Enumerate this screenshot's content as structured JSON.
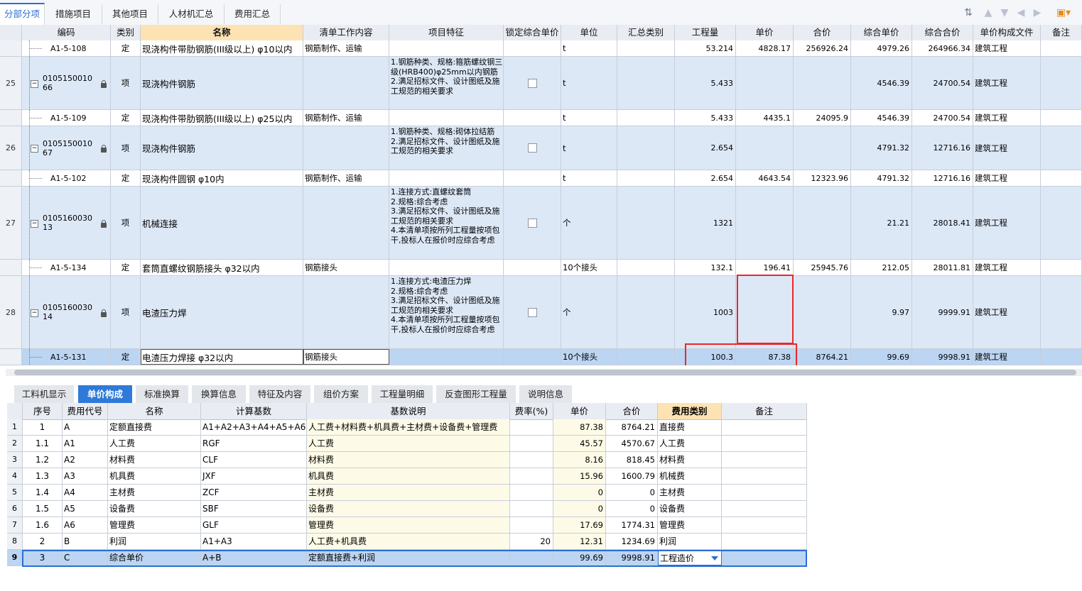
{
  "top_tabs": [
    "分部分项",
    "措施项目",
    "其他项目",
    "人材机汇总",
    "费用汇总"
  ],
  "grid": {
    "headers": [
      "编码",
      "类别",
      "名称",
      "清单工作内容",
      "项目特征",
      "锁定综合单价",
      "单位",
      "汇总类别",
      "工程量",
      "单价",
      "合价",
      "综合单价",
      "综合合价",
      "单价构成文件",
      "备注"
    ],
    "rows": [
      {
        "num": "",
        "code": "A1-5-108",
        "type": "定",
        "name": "现浇构件带肋钢筋(III级以上) φ10以内",
        "content": "钢筋制作、运输",
        "feature": "",
        "unit": "t",
        "qty": "53.214",
        "price": "4828.17",
        "total": "256926.24",
        "cprice": "4979.26",
        "ctotal": "264966.34",
        "file": "建筑工程"
      },
      {
        "num": "25",
        "code": "010515001066",
        "type": "项",
        "name": "现浇构件钢筋",
        "content": "",
        "feature": "1.钢筋种类、规格:箍筋螺纹钢三级(HRB400)φ25mm以内钢筋\n2.满足招标文件、设计图纸及施工规范的相关要求",
        "unit": "t",
        "qty": "5.433",
        "price": "",
        "total": "",
        "cprice": "4546.39",
        "ctotal": "24700.54",
        "file": "建筑工程"
      },
      {
        "num": "",
        "code": "A1-5-109",
        "type": "定",
        "name": "现浇构件带肋钢筋(III级以上) φ25以内",
        "content": "钢筋制作、运输",
        "feature": "",
        "unit": "t",
        "qty": "5.433",
        "price": "4435.1",
        "total": "24095.9",
        "cprice": "4546.39",
        "ctotal": "24700.54",
        "file": "建筑工程"
      },
      {
        "num": "26",
        "code": "010515001067",
        "type": "项",
        "name": "现浇构件钢筋",
        "content": "",
        "feature": "1.钢筋种类、规格:砌体拉结筋\n2.满足招标文件、设计图纸及施工规范的相关要求",
        "unit": "t",
        "qty": "2.654",
        "price": "",
        "total": "",
        "cprice": "4791.32",
        "ctotal": "12716.16",
        "file": "建筑工程"
      },
      {
        "num": "",
        "code": "A1-5-102",
        "type": "定",
        "name": "现浇构件圆钢 φ10内",
        "content": "钢筋制作、运输",
        "feature": "",
        "unit": "t",
        "qty": "2.654",
        "price": "4643.54",
        "total": "12323.96",
        "cprice": "4791.32",
        "ctotal": "12716.16",
        "file": "建筑工程"
      },
      {
        "num": "27",
        "code": "010516003013",
        "type": "项",
        "name": "机械连接",
        "content": "",
        "feature": "1.连接方式:直螺纹套筒\n2.规格:综合考虑\n3.满足招标文件、设计图纸及施工规范的相关要求\n4.本清单项按所列工程量按项包干,投标人在报价时应综合考虑",
        "unit": "个",
        "qty": "1321",
        "price": "",
        "total": "",
        "cprice": "21.21",
        "ctotal": "28018.41",
        "file": "建筑工程"
      },
      {
        "num": "",
        "code": "A1-5-134",
        "type": "定",
        "name": "套筒直螺纹钢筋接头 φ32以内",
        "content": "钢筋接头",
        "feature": "",
        "unit": "10个接头",
        "qty": "132.1",
        "price": "196.41",
        "total": "25945.76",
        "cprice": "212.05",
        "ctotal": "28011.81",
        "file": "建筑工程"
      },
      {
        "num": "28",
        "code": "010516003014",
        "type": "项",
        "name": "电渣压力焊",
        "content": "",
        "feature": "1.连接方式:电渣压力焊\n2.规格:综合考虑\n3.满足招标文件、设计图纸及施工规范的相关要求\n4.本清单项按所列工程量按项包干,投标人在报价时应综合考虑",
        "unit": "个",
        "qty": "1003",
        "price": "",
        "total": "",
        "cprice": "9.97",
        "ctotal": "9999.91",
        "file": "建筑工程"
      },
      {
        "num": "",
        "code": "A1-5-131",
        "type": "定",
        "name": "电渣压力焊接 φ32以内",
        "content": "钢筋接头",
        "feature": "",
        "unit": "10个接头",
        "qty": "100.3",
        "price": "87.38",
        "total": "8764.21",
        "cprice": "99.69",
        "ctotal": "9998.91",
        "file": "建筑工程"
      }
    ]
  },
  "bottom_tabs": [
    "工料机显示",
    "单价构成",
    "标准换算",
    "换算信息",
    "特征及内容",
    "组价方案",
    "工程量明细",
    "反查图形工程量",
    "说明信息"
  ],
  "bottom_grid": {
    "headers": [
      "序号",
      "费用代号",
      "名称",
      "计算基数",
      "基数说明",
      "费率(%)",
      "单价",
      "合价",
      "费用类别",
      "备注"
    ],
    "rows": [
      {
        "n": "1",
        "seq": "1",
        "code": "A",
        "name": "定额直接费",
        "base": "A1+A2+A3+A4+A5+A6",
        "desc": "人工费+材料费+机具费+主材费+设备费+管理费",
        "rate": "",
        "price": "87.38",
        "total": "8764.21",
        "cat": "直接费"
      },
      {
        "n": "2",
        "seq": "1.1",
        "code": "A1",
        "name": "人工费",
        "base": "RGF",
        "desc": "人工费",
        "rate": "",
        "price": "45.57",
        "total": "4570.67",
        "cat": "人工费"
      },
      {
        "n": "3",
        "seq": "1.2",
        "code": "A2",
        "name": "材料费",
        "base": "CLF",
        "desc": "材料费",
        "rate": "",
        "price": "8.16",
        "total": "818.45",
        "cat": "材料费"
      },
      {
        "n": "4",
        "seq": "1.3",
        "code": "A3",
        "name": "机具费",
        "base": "JXF",
        "desc": "机具费",
        "rate": "",
        "price": "15.96",
        "total": "1600.79",
        "cat": "机械费"
      },
      {
        "n": "5",
        "seq": "1.4",
        "code": "A4",
        "name": "主材费",
        "base": "ZCF",
        "desc": "主材费",
        "rate": "",
        "price": "0",
        "total": "0",
        "cat": "主材费"
      },
      {
        "n": "6",
        "seq": "1.5",
        "code": "A5",
        "name": "设备费",
        "base": "SBF",
        "desc": "设备费",
        "rate": "",
        "price": "0",
        "total": "0",
        "cat": "设备费"
      },
      {
        "n": "7",
        "seq": "1.6",
        "code": "A6",
        "name": "管理费",
        "base": "GLF",
        "desc": "管理费",
        "rate": "",
        "price": "17.69",
        "total": "1774.31",
        "cat": "管理费"
      },
      {
        "n": "8",
        "seq": "2",
        "code": "B",
        "name": "利润",
        "base": "A1+A3",
        "desc": "人工费+机具费",
        "rate": "20",
        "price": "12.31",
        "total": "1234.69",
        "cat": "利润"
      },
      {
        "n": "9",
        "seq": "3",
        "code": "C",
        "name": "综合单价",
        "base": "A+B",
        "desc": "定额直接费+利润",
        "rate": "",
        "price": "99.69",
        "total": "9998.91",
        "cat": "工程造价"
      }
    ]
  },
  "icons": [
    "filter-icon",
    "arrow-up-icon",
    "arrow-down-icon",
    "arrow-left-icon",
    "arrow-right-icon",
    "settings-icon"
  ]
}
